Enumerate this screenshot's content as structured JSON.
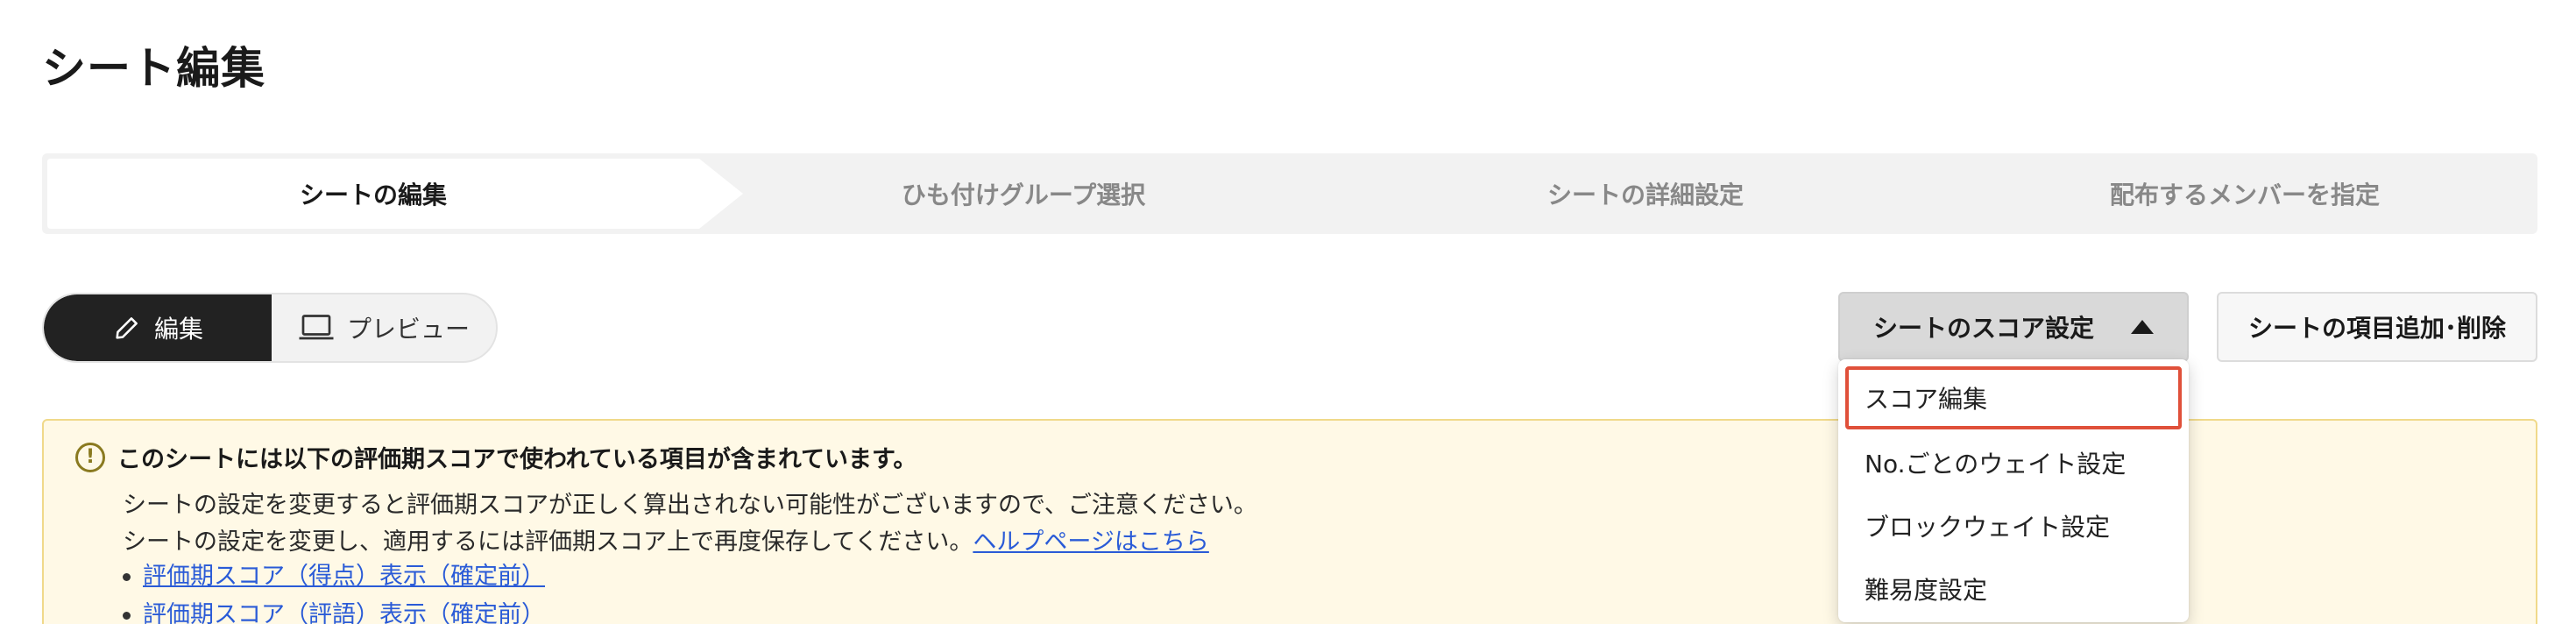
{
  "page": {
    "title": "シート編集"
  },
  "stepper": {
    "steps": [
      {
        "label": "シートの編集",
        "active": true
      },
      {
        "label": "ひも付けグループ選択",
        "active": false
      },
      {
        "label": "シートの詳細設定",
        "active": false
      },
      {
        "label": "配布するメンバーを指定",
        "active": false
      }
    ]
  },
  "mode_toggle": {
    "edit_label": "編集",
    "edit_icon": "pencil-icon",
    "preview_label": "プレビュー",
    "preview_icon": "laptop-icon"
  },
  "toolbar": {
    "score_settings_label": "シートのスコア設定",
    "score_settings_icon": "caret-up-icon",
    "items_label": "シートの項目追加･削除"
  },
  "dropdown": {
    "items": [
      {
        "label": "スコア編集",
        "selected": true
      },
      {
        "label": "No.ごとのウェイト設定",
        "selected": false
      },
      {
        "label": "ブロックウェイト設定",
        "selected": false
      },
      {
        "label": "難易度設定",
        "selected": false
      }
    ]
  },
  "warning": {
    "icon": "info-icon",
    "heading": "このシートには以下の評価期スコアで使われている項目が含まれています。",
    "line1": "シートの設定を変更すると評価期スコアが正しく算出されない可能性がございますので、ご注意ください。",
    "line2": "シートの設定を変更し、適用するには評価期スコア上で再度保存してください。",
    "help_link": "ヘルプページはこちら",
    "links": [
      "評価期スコア（得点）表示（確定前）",
      "評価期スコア（評語）表示（確定前）"
    ]
  },
  "colors": {
    "active_toggle": "#222222",
    "warning_bg": "#fff9e6",
    "warning_border": "#f0d98a",
    "link": "#2a5bd7",
    "highlight": "#e0503a"
  }
}
